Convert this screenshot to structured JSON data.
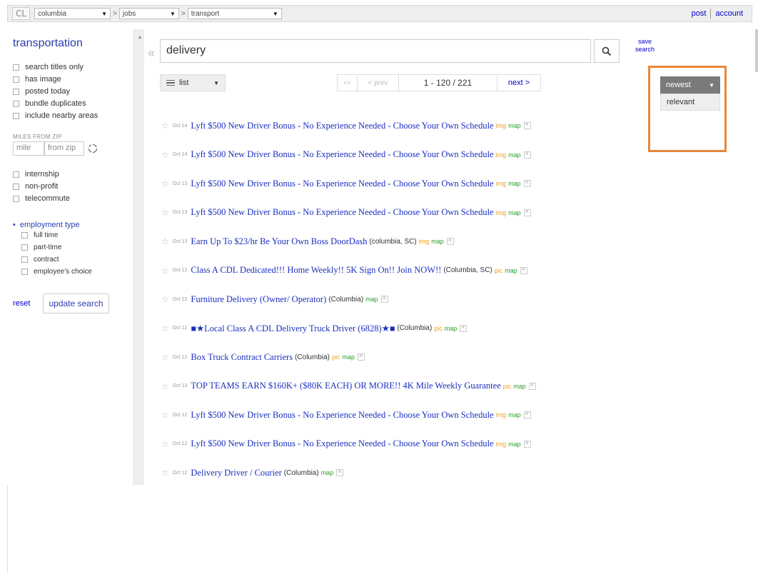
{
  "topbar": {
    "logo": "CL",
    "location": "columbia",
    "category": "jobs",
    "subcategory": "transport",
    "separator": ">",
    "post": "post",
    "account": "account"
  },
  "sidebar": {
    "title": "transportation",
    "filters": [
      "search titles only",
      "has image",
      "posted today",
      "bundle duplicates",
      "include nearby areas"
    ],
    "miles_label": "MILES FROM ZIP",
    "miles_placeholder": "mile",
    "zip_placeholder": "from zip",
    "extra_filters": [
      "internship",
      "non-profit",
      "telecommute"
    ],
    "employment_header": "employment type",
    "employment_options": [
      "full time",
      "part-time",
      "contract",
      "employee's choice"
    ],
    "reset": "reset",
    "update": "update search"
  },
  "search": {
    "query": "delivery",
    "save_line1": "save",
    "save_line2": "search"
  },
  "view": {
    "label": "list"
  },
  "pager": {
    "first": "<<",
    "prev": "< prev",
    "range": "1 - 120 / 221",
    "next": "next >"
  },
  "sort": {
    "selected": "newest",
    "other": "relevant"
  },
  "listings": [
    {
      "date": "Oct 14",
      "title": "Lyft $500 New Driver Bonus - No Experience Needed - Choose Your Own Schedule",
      "loc": "",
      "tag": "img",
      "map": "map"
    },
    {
      "date": "Oct 14",
      "title": "Lyft $500 New Driver Bonus - No Experience Needed - Choose Your Own Schedule",
      "loc": "",
      "tag": "img",
      "map": "map"
    },
    {
      "date": "Oct 13",
      "title": "Lyft $500 New Driver Bonus - No Experience Needed - Choose Your Own Schedule",
      "loc": "",
      "tag": "img",
      "map": "map"
    },
    {
      "date": "Oct 13",
      "title": "Lyft $500 New Driver Bonus - No Experience Needed - Choose Your Own Schedule",
      "loc": "",
      "tag": "img",
      "map": "map"
    },
    {
      "date": "Oct 13",
      "title": "Earn Up To $23/hr Be Your Own Boss DoorDash",
      "loc": "(columbia, SC)",
      "tag": "img",
      "map": "map"
    },
    {
      "date": "Oct 12",
      "title": "Class A CDL Dedicated!!! Home Weekly!! 5K Sign On!! Join NOW!!",
      "loc": "(Columbia, SC)",
      "tag": "pic",
      "map": "map"
    },
    {
      "date": "Oct 12",
      "title": "Furniture Delivery (Owner/ Operator)",
      "loc": "(Columbia)",
      "tag": "",
      "map": "map"
    },
    {
      "date": "Oct 12",
      "title": "■★Local Class A CDL Delivery Truck Driver (6828)★■",
      "loc": "(Columbia)",
      "tag": "pic",
      "map": "map"
    },
    {
      "date": "Oct 12",
      "title": "Box Truck Contract Carriers",
      "loc": "(Columbia)",
      "tag": "pic",
      "map": "map"
    },
    {
      "date": "Oct 13",
      "title": "TOP TEAMS EARN $160K+ ($80K EACH) OR MORE!! 4K Mile Weekly Guarantee",
      "loc": "",
      "tag": "pic",
      "map": "map"
    },
    {
      "date": "Oct 12",
      "title": "Lyft $500 New Driver Bonus - No Experience Needed - Choose Your Own Schedule",
      "loc": "",
      "tag": "img",
      "map": "map"
    },
    {
      "date": "Oct 12",
      "title": "Lyft $500 New Driver Bonus - No Experience Needed - Choose Your Own Schedule",
      "loc": "",
      "tag": "img",
      "map": "map"
    },
    {
      "date": "Oct 12",
      "title": "Delivery Driver / Courier",
      "loc": "(Columbia)",
      "tag": "",
      "map": "map"
    }
  ]
}
